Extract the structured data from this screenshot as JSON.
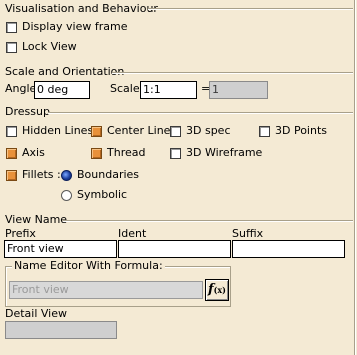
{
  "visualisation": {
    "title": "Visualisation and Behaviour",
    "display_view_frame": {
      "label": "Display view frame",
      "checked": false
    },
    "lock_view": {
      "label": "Lock View",
      "checked": false
    }
  },
  "scale_orientation": {
    "title": "Scale and Orientation",
    "angle_label": "Angle:",
    "angle_value": "0 deg",
    "scale_label": "Scale:",
    "scale_value": "1:1",
    "equals": "=",
    "result_value": "1"
  },
  "dressup": {
    "title": "Dressup",
    "hidden_lines": {
      "label": "Hidden Lines",
      "checked": false
    },
    "center_line": {
      "label": "Center Line",
      "checked": true
    },
    "spec_3d": {
      "label": "3D spec",
      "checked": false
    },
    "points_3d": {
      "label": "3D Points",
      "checked": false
    },
    "axis": {
      "label": "Axis",
      "checked": true
    },
    "thread": {
      "label": "Thread",
      "checked": true
    },
    "wireframe_3d": {
      "label": "3D Wireframe",
      "checked": false
    },
    "fillets": {
      "label": "Fillets :",
      "checked": true
    },
    "boundaries": {
      "label": "Boundaries",
      "selected": true
    },
    "symbolic": {
      "label": "Symbolic",
      "selected": false
    }
  },
  "view_name": {
    "title": "View Name",
    "prefix_label": "Prefix",
    "ident_label": "Ident",
    "suffix_label": "Suffix",
    "prefix_value": "Front view",
    "ident_value": "",
    "suffix_value": "",
    "name_editor_title": "Name Editor With Formula:",
    "formula_value": "Front view",
    "fx_label": "f",
    "fx_sub": "(x)"
  },
  "detail_view": {
    "label": "Detail View",
    "value": ""
  },
  "colors": {
    "background": "#f4ead4",
    "checked": "#e8913a",
    "radio_selected": "#1c3f9e",
    "disabled_field": "#cfcfcf"
  }
}
